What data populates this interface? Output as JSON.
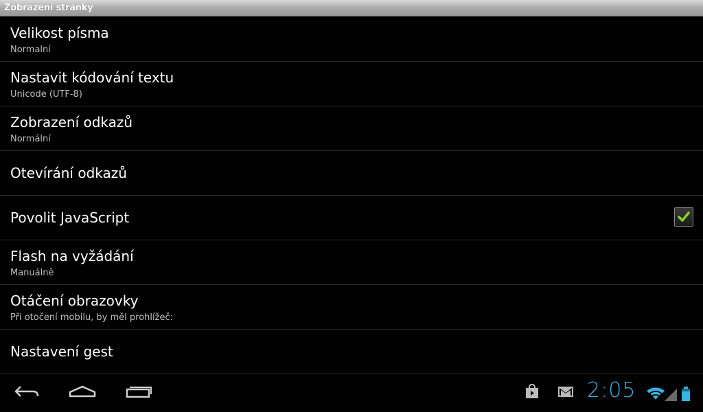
{
  "window": {
    "title": "Zobrazení stránky"
  },
  "settings": [
    {
      "label": "Velikost písma",
      "summary": "Normalní"
    },
    {
      "label": "Nastavit kódování textu",
      "summary": "Unicode (UTF-8)"
    },
    {
      "label": "Zobrazení odkazů",
      "summary": "Normální"
    },
    {
      "label": "Otevírání odkazů",
      "summary": ""
    },
    {
      "label": "Povolit JavaScript",
      "summary": "",
      "checked": true
    },
    {
      "label": "Flash na vyžádání",
      "summary": "Manuálně"
    },
    {
      "label": "Otáčení obrazovky",
      "summary": "Při otočení mobilu, by měl prohlížeč:"
    },
    {
      "label": "Nastavení gest",
      "summary": ""
    }
  ],
  "navbar": {
    "back_icon": "back-arrow-icon",
    "home_icon": "home-icon",
    "recents_icon": "recent-apps-icon"
  },
  "status": {
    "time": "2:05",
    "icons": [
      "play-store-bag-icon",
      "gmail-icon",
      "wifi-icon",
      "signal-icon",
      "battery-icon"
    ],
    "accent_color": "#33b5e5"
  }
}
